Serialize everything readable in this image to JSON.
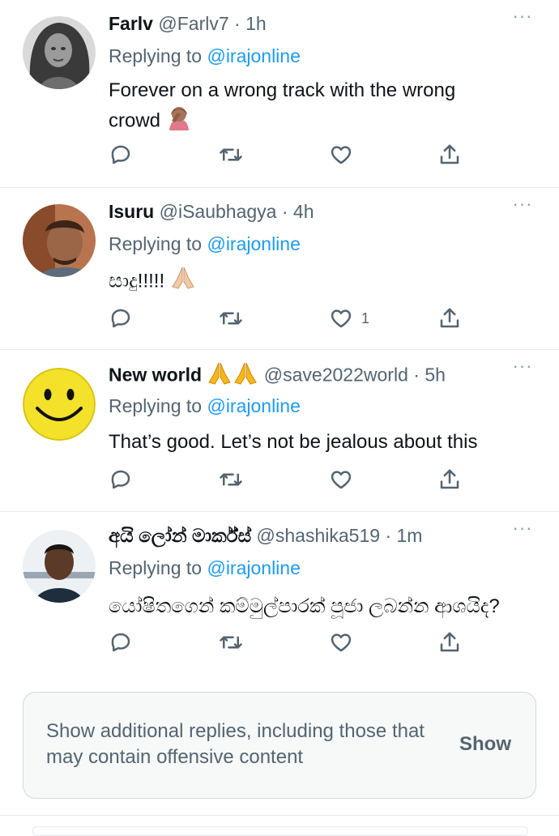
{
  "tweets": [
    {
      "name": "Farlv",
      "handle": "@Farlv7",
      "dot": "·",
      "time": "1h",
      "more": "···",
      "replying_prefix": "Replying to",
      "mention": "@irajonline",
      "text": "Forever on a wrong track with the wrong crowd",
      "likes": ""
    },
    {
      "name": "Isuru",
      "handle": "@iSaubhagya",
      "dot": "·",
      "time": "4h",
      "more": "···",
      "replying_prefix": "Replying to",
      "mention": "@irajonline",
      "text": "සාදු!!!!!",
      "likes": "1"
    },
    {
      "name": "New world",
      "handle": "@save2022world",
      "dot": "·",
      "time": "5h",
      "more": "···",
      "replying_prefix": "Replying to",
      "mention": "@irajonline",
      "text": "That’s good. Let’s not be jealous about this",
      "likes": ""
    },
    {
      "name": "අයි ලෝන් මාර්ක්ස්",
      "handle": "@shashika519",
      "dot": "·",
      "time": "1m",
      "more": "···",
      "replying_prefix": "Replying to",
      "mention": "@irajonline",
      "text": "යෝෂිතගෙන් කම්මුල්පාරක් පූජා ලබන්න ආශයිද?",
      "likes": ""
    }
  ],
  "notice": {
    "text": "Show additional replies, including those that may contain offensive content",
    "button": "Show"
  },
  "colors": {
    "text": "#0f1419",
    "secondary": "#536471",
    "link": "#1d9bf0",
    "divider": "#e6ecf0"
  },
  "icons": [
    "reply-icon",
    "retweet-icon",
    "like-icon",
    "share-icon",
    "more-icon",
    "facepalm-emoji",
    "folded-hands-emoji"
  ]
}
